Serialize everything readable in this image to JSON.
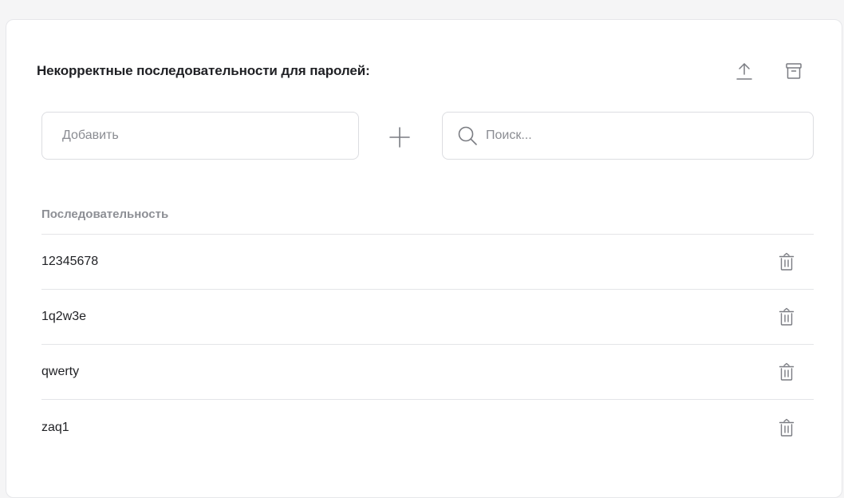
{
  "panel": {
    "title": "Некорректные последовательности для паролей:",
    "upload_icon": "upload-icon",
    "archive_icon": "archive-icon"
  },
  "add": {
    "placeholder": "Добавить",
    "value": "",
    "add_icon": "plus-icon"
  },
  "search": {
    "placeholder": "Поиск...",
    "value": "",
    "icon": "search-icon"
  },
  "table": {
    "columns": [
      "Последовательность"
    ],
    "rows": [
      {
        "sequence": "12345678",
        "action_icon": "trash-icon"
      },
      {
        "sequence": "1q2w3e",
        "action_icon": "trash-icon"
      },
      {
        "sequence": "qwerty",
        "action_icon": "trash-icon"
      },
      {
        "sequence": "zaq1",
        "action_icon": "trash-icon"
      }
    ]
  },
  "colors": {
    "text": "#1f2024",
    "muted": "#8d8f95",
    "border": "#dcdde1",
    "icon": "#7a7c82"
  }
}
